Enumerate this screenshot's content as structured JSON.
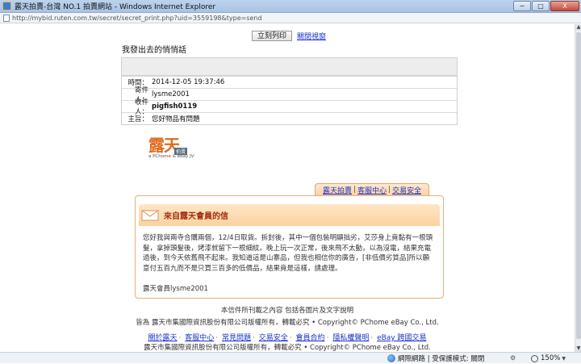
{
  "window": {
    "title": "露天拍賣-台灣 NO.1 拍賣網站 - Windows Internet Explorer",
    "url": "http://mybid.ruten.com.tw/secret/secret_print.php?uid=3559198&type=send",
    "minimize": "─",
    "maximize": "□",
    "close": "X"
  },
  "toolbar": {
    "print_label": "立刻列印",
    "close_label": "關閉視窗"
  },
  "page": {
    "title": "我發出去的悄悄話"
  },
  "message": {
    "rows": [
      {
        "label": "時間：",
        "value": "2014-12-05 19:37:46",
        "bold": false
      },
      {
        "label": "寄件人：",
        "value": "lysme2001",
        "bold": false
      },
      {
        "label": "收件人：",
        "value": "pigfish0119",
        "bold": true
      },
      {
        "label": "主旨：",
        "value": "您好物品有問題",
        "bold": false
      }
    ]
  },
  "logo": {
    "name": "露天",
    "tag": "拍賣",
    "sub": "a PChome & eBay JV"
  },
  "nav": {
    "tabs": [
      "露天拍賣",
      "客服中心",
      "交易安全"
    ],
    "separator": "|"
  },
  "mail": {
    "heading": "來自露天會員的信",
    "body": "您好我與兩寺合購兩個，12/4日取貨。拆封後，其中一個包裝明顯拙劣，艾莎身上竟黏有一根頭髮，拿掉頭髮後，烤漆就留下一根細紋。晚上玩一次正常，後來飛不太動，以為沒電，結果充電過後，到今天依舊飛不起來。我知道這是山寨品，但我也相信你的廣告，[非低價劣質品]所以願意付五百九而不是只買三百多的低價品，結果竟是這樣，請處理。",
    "signature": "露天會員lysme2001"
  },
  "footer": {
    "line1": "本信件所刊載之內容 包括各圖片及文字說明",
    "line2": "皆為 露天市集國際資訊股份有限公司版權所有，轉載必究 • Copyright©   PChome eBay Co., Ltd.",
    "links": [
      "關於露天",
      "客服中心",
      "常見問題",
      "交易安全",
      "會員合約",
      "隱私權聲明",
      "eBay 跨國交易"
    ],
    "link_separator": "‧",
    "copyright": "露天市集國際資訊股份有限公司版權所有，轉載必究 • Copyright©   PChome eBay Co., Ltd."
  },
  "status": {
    "zone": "網際網路 | 受保護模式: 關閉",
    "zoom": "150%"
  }
}
